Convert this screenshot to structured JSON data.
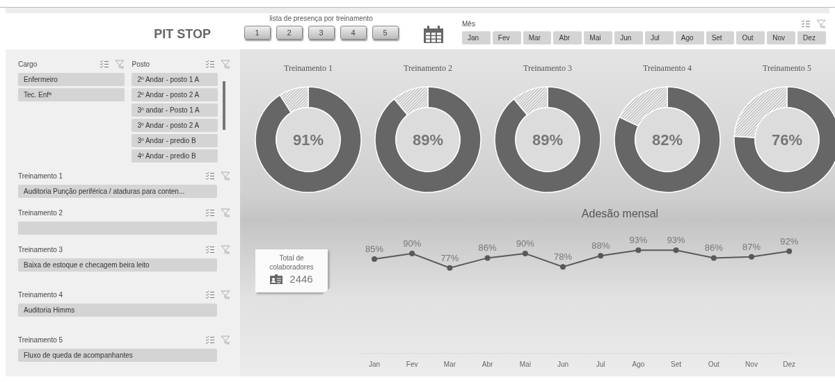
{
  "title": "PIT STOP",
  "training_buttons": {
    "caption": "lista de presença por treinamento",
    "buttons": [
      {
        "label": "1"
      },
      {
        "label": "2"
      },
      {
        "label": "3"
      },
      {
        "label": "4"
      },
      {
        "label": "5"
      }
    ]
  },
  "month_slicer": {
    "title": "Mês",
    "items": [
      {
        "label": "Jan",
        "selected": true
      },
      {
        "label": "Fev",
        "selected": true
      },
      {
        "label": "Mar",
        "selected": true
      },
      {
        "label": "Abr",
        "selected": true
      },
      {
        "label": "Mai",
        "selected": true
      },
      {
        "label": "Jun",
        "selected": true
      },
      {
        "label": "Jul",
        "selected": true
      },
      {
        "label": "Ago",
        "selected": true
      },
      {
        "label": "Set",
        "selected": true
      },
      {
        "label": "Out",
        "selected": true
      },
      {
        "label": "Nov",
        "selected": true
      },
      {
        "label": "Dez",
        "selected": true
      }
    ]
  },
  "cargo_slicer": {
    "title": "Cargo",
    "items": [
      {
        "label": "Enfermeiro",
        "selected": true
      },
      {
        "label": "Tec. Enfª",
        "selected": true
      }
    ]
  },
  "posto_slicer": {
    "title": "Posto",
    "items": [
      {
        "label": "2º Andar - posto 1  A",
        "selected": true
      },
      {
        "label": "2º Andar - posto 2  A",
        "selected": true
      },
      {
        "label": "3º andar - Posto 1 A",
        "selected": true
      },
      {
        "label": "3º Andar - posto 2 A",
        "selected": true
      },
      {
        "label": "3º Andar - predio B",
        "selected": true
      },
      {
        "label": "4º Andar - predio B",
        "selected": true
      }
    ]
  },
  "training_slicers": [
    {
      "title": "Treinamento 1",
      "items": [
        {
          "label": "Auditoria Punção periférica / ataduras para conten...",
          "selected": true
        }
      ]
    },
    {
      "title": "Treinamento 2",
      "items": [
        {
          "selected": true
        }
      ]
    },
    {
      "title": "Treinamento 3",
      "items": [
        {
          "label": "Baixa de estoque e checagem beira leito",
          "selected": true
        }
      ]
    },
    {
      "title": "Treinamento 4",
      "items": [
        {
          "label": "Auditoria Himms",
          "selected": true
        }
      ]
    },
    {
      "title": "Treinamento 5",
      "items": [
        {
          "label": "Fluxo de queda de acompanhantes",
          "selected": true
        }
      ]
    }
  ],
  "donuts": [
    {
      "chart_data": {
        "type": "donut",
        "title": "Treinamento 1",
        "values": [
          91,
          9
        ],
        "annotations": [
          "91%"
        ]
      }
    },
    {
      "chart_data": {
        "type": "donut",
        "title": "Treinamento 2",
        "values": [
          89,
          11
        ],
        "annotations": [
          "89%"
        ]
      }
    },
    {
      "chart_data": {
        "type": "donut",
        "title": "Treinamento 3",
        "values": [
          89,
          11
        ],
        "annotations": [
          "89%"
        ]
      }
    },
    {
      "chart_data": {
        "type": "donut",
        "title": "Treinamento 4",
        "values": [
          82,
          18
        ],
        "annotations": [
          "82%"
        ]
      }
    },
    {
      "chart_data": {
        "type": "donut",
        "title": "Treinamento 5",
        "values": [
          76,
          24
        ],
        "annotations": [
          "76%"
        ]
      }
    }
  ],
  "total_card": {
    "label": "Total de colaboradores",
    "value": "2446"
  },
  "monthly_chart": {
    "chart_data": {
      "type": "line",
      "title": "Adesão mensal",
      "categories": [
        "Jan",
        "Fev",
        "Mar",
        "Abr",
        "Mai",
        "Jun",
        "Jul",
        "Ago",
        "Set",
        "Out",
        "Nov",
        "Dez"
      ],
      "series": [
        {
          "color": "#595959",
          "marker": "circle",
          "values": [
            85,
            90,
            77,
            86,
            90,
            78,
            88,
            93,
            93,
            86,
            87,
            92
          ],
          "value_labels": [
            "85%",
            "90%",
            "77%",
            "86%",
            "90%",
            "78%",
            "88%",
            "93%",
            "93%",
            "86%",
            "87%",
            "92%"
          ]
        }
      ]
    }
  }
}
